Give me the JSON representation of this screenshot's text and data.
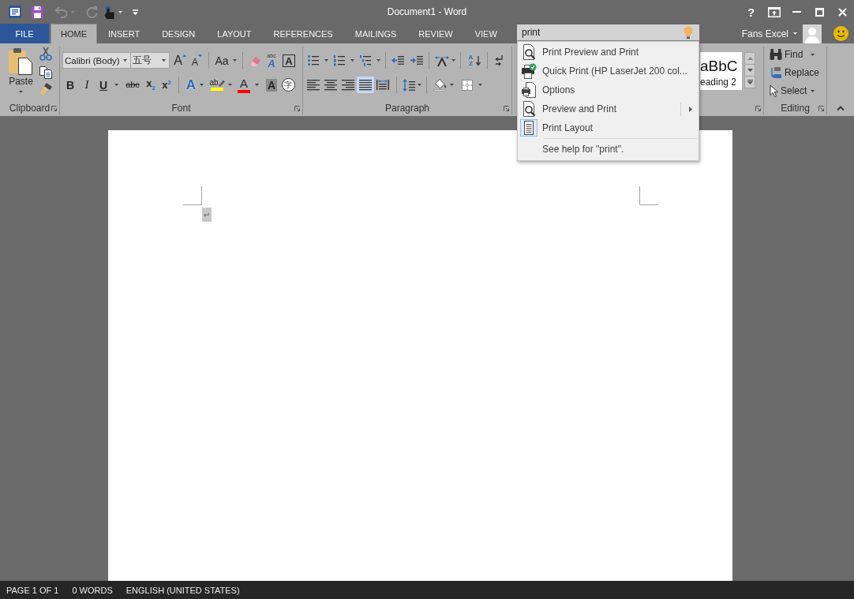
{
  "window": {
    "title": "Document1 - Word",
    "help": "?",
    "quick_access": [
      {
        "kind": "save",
        "disabled": false
      },
      {
        "kind": "undo",
        "disabled": true
      },
      {
        "kind": "redo",
        "disabled": true
      },
      {
        "kind": "touch",
        "disabled": false
      },
      {
        "kind": "customize",
        "disabled": false
      }
    ]
  },
  "tabs": [
    {
      "label": "FILE",
      "kind": "file",
      "selected": false
    },
    {
      "label": "HOME",
      "kind": "tab",
      "selected": true
    },
    {
      "label": "INSERT",
      "kind": "tab",
      "selected": false
    },
    {
      "label": "DESIGN",
      "kind": "tab",
      "selected": false
    },
    {
      "label": "LAYOUT",
      "kind": "tab",
      "selected": false
    },
    {
      "label": "REFERENCES",
      "kind": "tab",
      "selected": false
    },
    {
      "label": "MAILINGS",
      "kind": "tab",
      "selected": false
    },
    {
      "label": "REVIEW",
      "kind": "tab",
      "selected": false
    },
    {
      "label": "VIEW",
      "kind": "tab",
      "selected": false
    }
  ],
  "tell_me": {
    "value": "print",
    "menu": [
      {
        "label": "Print Preview and Print",
        "kind": "preview",
        "checked": false,
        "submenu": false
      },
      {
        "label": "Quick Print (HP LaserJet 200 col...",
        "kind": "quick_print",
        "checked": false,
        "submenu": false
      },
      {
        "label": "Options",
        "kind": "options",
        "checked": false,
        "submenu": false
      },
      {
        "label": "Preview and Print",
        "kind": "preview",
        "checked": false,
        "submenu": true
      },
      {
        "label": "Print Layout",
        "kind": "layout",
        "checked": true,
        "submenu": false
      }
    ],
    "help": "See help for \"print\"."
  },
  "account": {
    "name": "Fans Excel"
  },
  "ribbon": {
    "clipboard": {
      "label": "Clipboard",
      "paste": "Paste"
    },
    "font": {
      "label": "Font",
      "font_name": "Calibri (Body)",
      "font_size": "五号",
      "row1": [
        {
          "kind": "grow",
          "glyph": "A"
        },
        {
          "kind": "shrink",
          "glyph": "A"
        },
        {
          "kind": "change_case",
          "glyph": "Aa"
        },
        {
          "kind": "clear_formatting"
        },
        {
          "kind": "phonetic_guide",
          "glyph": "A",
          "ruby": "abc"
        },
        {
          "kind": "character_border",
          "glyph": "A"
        }
      ],
      "row2": [
        {
          "kind": "bold",
          "glyph": "B"
        },
        {
          "kind": "italic",
          "glyph": "I"
        },
        {
          "kind": "underline",
          "glyph": "U"
        },
        {
          "kind": "strikethrough",
          "glyph": "abc"
        },
        {
          "kind": "subscript",
          "glyph": "x$_{2}$"
        },
        {
          "kind": "superscript",
          "glyph": "x$^{2}$"
        },
        {
          "kind": "text_effects",
          "glyph": "A"
        },
        {
          "kind": "highlight",
          "glyph": "ab",
          "color": "#ffff00"
        },
        {
          "kind": "font_color",
          "glyph": "A",
          "color": "#ff0000"
        },
        {
          "kind": "shading",
          "glyph": "A"
        },
        {
          "kind": "enclose",
          "glyph": "字"
        }
      ]
    },
    "paragraph": {
      "label": "Paragraph",
      "row1": [
        {
          "kind": "bullets"
        },
        {
          "kind": "numbering"
        },
        {
          "kind": "multilevel"
        },
        {
          "kind": "decrease_indent"
        },
        {
          "kind": "increase_indent"
        },
        {
          "kind": "asian_layout"
        },
        {
          "kind": "sort",
          "glyph": "AZ"
        },
        {
          "kind": "show_marks"
        }
      ],
      "alignment": [
        {
          "kind": "left",
          "selected": false
        },
        {
          "kind": "center",
          "selected": false
        },
        {
          "kind": "right",
          "selected": false
        },
        {
          "kind": "justify",
          "selected": true
        },
        {
          "kind": "distributed",
          "selected": false
        }
      ],
      "row2": [
        {
          "kind": "line_spacing"
        },
        {
          "kind": "shading"
        },
        {
          "kind": "borders"
        }
      ]
    },
    "styles": {
      "preview": "aBbC",
      "name": "eading 2"
    },
    "editing": {
      "label": "Editing",
      "commands": [
        {
          "label": "Find",
          "kind": "find",
          "dropdown": true
        },
        {
          "label": "Replace",
          "kind": "replace",
          "dropdown": false
        },
        {
          "label": "Select",
          "kind": "select",
          "dropdown": true
        }
      ]
    }
  },
  "document": {
    "paragraph_mark": "↵",
    "selected": true
  },
  "status_bar": [
    "PAGE 1 OF 1",
    "0 WORDS",
    "ENGLISH (UNITED STATES)"
  ]
}
